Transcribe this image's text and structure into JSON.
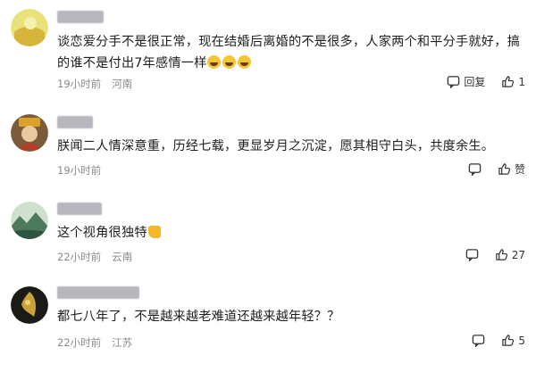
{
  "comments": [
    {
      "text": "谈恋爱分手不是很正常，现在结婚后离婚的不是很多，人家两个和平分手就好，搞的谁不是付出7年感情一样",
      "emoji": "😂😂😂",
      "time": "19小时前",
      "location": "河南",
      "reply_label": "回复",
      "like_count": "1"
    },
    {
      "text": "朕闻二人情深意重，历经七载，更显岁月之沉淀，愿其相守白头，共度余生。",
      "time": "19小时前",
      "location": "",
      "reply_label": "",
      "like_count": "赞"
    },
    {
      "text": "这个视角很独特",
      "emoji": "👍",
      "time": "22小时前",
      "location": "云南",
      "reply_label": "",
      "like_count": "27"
    },
    {
      "text": "都七八年了，不是越来越老难道还越来越年轻？？",
      "time": "22小时前",
      "location": "江苏",
      "reply_label": "",
      "like_count": "5"
    }
  ],
  "icons": {
    "reply": "reply-icon",
    "like": "thumbs-up-icon"
  },
  "colors": {
    "text": "#1e1e1e",
    "meta": "#8a8a8a",
    "blurred_name": "#b7b7bd"
  }
}
